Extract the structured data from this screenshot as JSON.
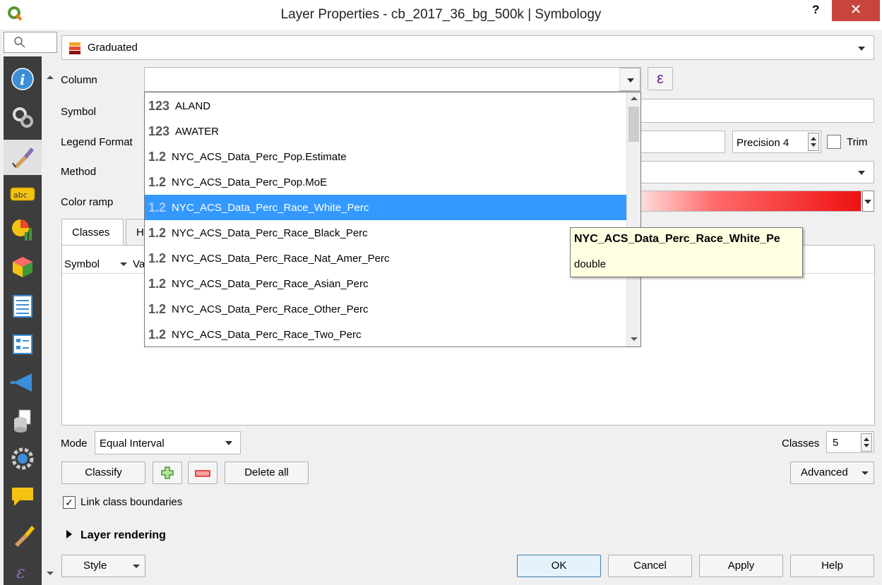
{
  "window": {
    "title": "Layer Properties - cb_2017_36_bg_500k | Symbology",
    "help": "?",
    "close": "✕"
  },
  "renderer": {
    "label": "Graduated"
  },
  "form": {
    "column_label": "Column",
    "symbol_label": "Symbol",
    "legend_format_label": "Legend Format",
    "method_label": "Method",
    "color_ramp_label": "Color ramp",
    "precision": "Precision 4",
    "trim": "Trim",
    "epsilon": "ε"
  },
  "tabs": [
    {
      "label": "Classes"
    },
    {
      "label": "H"
    }
  ],
  "tree_header": {
    "symbol": "Symbol",
    "values_partial": "Va"
  },
  "mode": {
    "label": "Mode",
    "value": "Equal Interval"
  },
  "classes": {
    "label": "Classes",
    "value": "5"
  },
  "buttons": {
    "classify": "Classify",
    "delete_all": "Delete all",
    "advanced": "Advanced",
    "style": "Style",
    "ok": "OK",
    "cancel": "Cancel",
    "apply": "Apply",
    "help": "Help"
  },
  "link_boundaries": "Link class boundaries",
  "layer_rendering": "Layer rendering",
  "dropdown_items": [
    {
      "type": "123",
      "name": "ALAND"
    },
    {
      "type": "123",
      "name": "AWATER"
    },
    {
      "type": "1.2",
      "name": "NYC_ACS_Data_Perc_Pop.Estimate"
    },
    {
      "type": "1.2",
      "name": "NYC_ACS_Data_Perc_Pop.MoE"
    },
    {
      "type": "1.2",
      "name": "NYC_ACS_Data_Perc_Race_White_Perc",
      "selected": true
    },
    {
      "type": "1.2",
      "name": "NYC_ACS_Data_Perc_Race_Black_Perc"
    },
    {
      "type": "1.2",
      "name": "NYC_ACS_Data_Perc_Race_Nat_Amer_Perc"
    },
    {
      "type": "1.2",
      "name": "NYC_ACS_Data_Perc_Race_Asian_Perc"
    },
    {
      "type": "1.2",
      "name": "NYC_ACS_Data_Perc_Race_Other_Perc"
    },
    {
      "type": "1.2",
      "name": "NYC_ACS_Data_Perc_Race_Two_Perc"
    }
  ],
  "tooltip": {
    "title": "NYC_ACS_Data_Perc_Race_White_Pe",
    "type": "double"
  },
  "sidebar_icons": [
    "info-icon",
    "source-icon",
    "symbology-icon",
    "labels-icon",
    "diagrams-icon",
    "3d-view-icon",
    "fields-icon",
    "attributes-form-icon",
    "joins-icon",
    "auxiliary-storage-icon",
    "actions-icon",
    "display-icon",
    "rendering-icon",
    "variables-icon"
  ],
  "colors": {
    "selection": "#3399ff",
    "close": "#c7453a",
    "sidebar": "#3d3d3d",
    "tooltip": "#ffffe1"
  }
}
